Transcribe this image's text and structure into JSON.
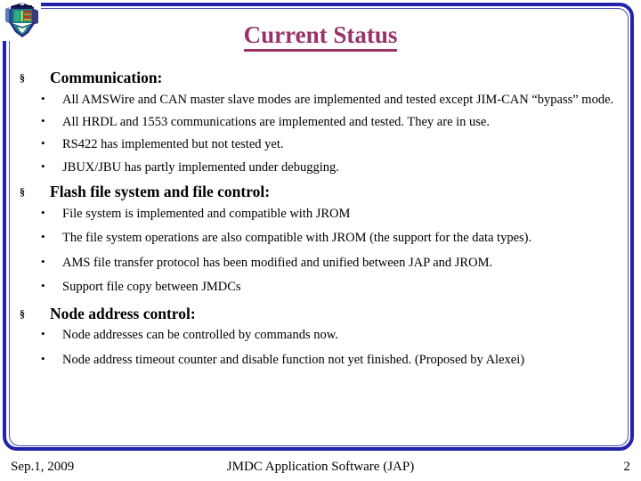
{
  "slide": {
    "title": "Current Status",
    "title_color": "#993366",
    "frame_color": "#2222aa",
    "logo_name": "ams-detector-logo",
    "section_marker": "§",
    "bullet_marker": "•"
  },
  "sections": [
    {
      "heading": "Communication:",
      "bullets": [
        "All AMSWire and CAN master slave modes are implemented and tested except JIM-CAN “bypass” mode.",
        "All HRDL and 1553 communications are implemented and tested. They are in use.",
        "RS422 has implemented but not tested yet.",
        "JBUX/JBU has partly implemented under debugging."
      ]
    },
    {
      "heading": "Flash file system and file control:",
      "bullets": [
        "File system is implemented and compatible with JROM",
        "The file system operations are also compatible with JROM (the support for the data types).",
        "AMS file transfer protocol has been modified and unified between JAP and JROM.",
        "Support file copy between JMDCs"
      ]
    },
    {
      "heading": "Node address control:",
      "bullets": [
        "Node addresses can be controlled by commands now.",
        "Node address timeout counter and disable function not yet finished. (Proposed by Alexei)"
      ]
    }
  ],
  "footer": {
    "date": "Sep.1, 2009",
    "center": "JMDC Application Software (JAP)",
    "page": "2"
  }
}
